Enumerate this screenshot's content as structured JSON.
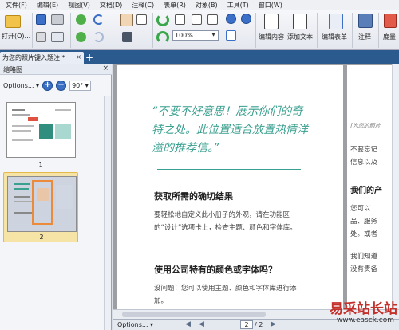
{
  "menu": [
    "文件(F)",
    "编辑(E)",
    "视图(V)",
    "文档(D)",
    "注释(C)",
    "表单(R)",
    "对象(B)",
    "工具(T)",
    "窗口(W)"
  ],
  "toolbar": {
    "open_label": "打开(O)...",
    "zoom_value": "100%",
    "edit_content_label": "编辑内容",
    "add_text_label": "添加文本",
    "edit_form_label": "编辑表单",
    "annotate_label": "注释",
    "measure_label": "度量"
  },
  "tab": {
    "title": "为您的照片键入题注 *",
    "close": "×",
    "add": "+"
  },
  "panel": {
    "title": "缩略图",
    "close": "×",
    "options": "Options...",
    "rotate": "90°",
    "pages": [
      {
        "num": "1"
      },
      {
        "num": "2"
      }
    ]
  },
  "page": {
    "quote": "“不要不好意思！展示你们的奇特之处。此位置适合放置热情洋溢的推荐信。”",
    "h1": "获取所需的确切结果",
    "p1": "要轻松地自定义此小册子的外观，请在功能区的“设计”选项卡上，检查主题、颜色和字体库。",
    "h2": "使用公司特有的颜色或字体吗？",
    "p2": "没问题！您可以使用主题、颜色和字体库进行添加。"
  },
  "page2": {
    "caption": "[为您的照片",
    "line1": "不要忘记",
    "line2": "信息以及",
    "heading": "我们的产",
    "line3": "您可以",
    "line4": "品、服务",
    "line5": "处。或者",
    "line6": "我们知道",
    "line7": "没有责备"
  },
  "statusbar": {
    "options": "Options...",
    "page": "2",
    "total": "/ 2"
  },
  "watermark": {
    "text": "易采站长站",
    "url": "www.easck.com"
  },
  "colors": {
    "accent_teal": "#3aa08f",
    "tab_blue": "#2b5a8f",
    "thumb_select": "#f6e3a6"
  }
}
